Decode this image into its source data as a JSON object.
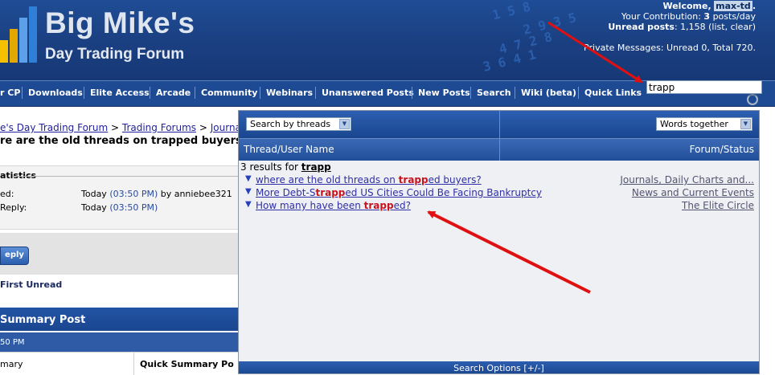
{
  "header": {
    "logo_title": "Big Mike's",
    "logo_subtitle": "Day Trading Forum",
    "welcome_prefix": "Welcome,",
    "username": "max-td",
    "welcome_suffix": ".",
    "contribution": "Your Contribution:",
    "contribution_count": "3",
    "contribution_suffix": "posts/day",
    "unread_label": "Unread posts",
    "unread_value": ": 1,158 (list, clear)",
    "private_messages": "Private Messages: Unread 0, Total 720."
  },
  "navbar": {
    "items": [
      "r CP",
      "Downloads",
      "Elite Access",
      "Arcade",
      "Community",
      "Webinars",
      "Unanswered Posts",
      "New Posts",
      "Search",
      "Wiki (beta)",
      "Quick Links"
    ],
    "search_value": "trapp"
  },
  "breadcrumb": {
    "items": [
      "e's Day Trading Forum",
      "Trading Forums",
      "Journals"
    ],
    "separator": ">"
  },
  "thread_title": "re are the old threads on trapped buyers",
  "stats": {
    "legend": "atistics",
    "rows": [
      {
        "label": "ed:",
        "date": "Today",
        "time": "(03:50 PM)",
        "by": "by anniebee321"
      },
      {
        "label": "Reply:",
        "date": "Today",
        "time": "(03:50 PM)",
        "by": ""
      }
    ]
  },
  "reply_button": "eply",
  "first_unread": "First Unread",
  "summary": {
    "title": "Summary Post",
    "date": "50 PM",
    "col1": "mary",
    "col2": "Quick Summary Po"
  },
  "popup": {
    "search_mode": "Search by threads",
    "match_mode": "Words together",
    "col_thread": "Thread/User Name",
    "col_forum": "Forum/Status",
    "results_prefix": "3 results for",
    "results_term": "trapp",
    "results": [
      {
        "before": "where are the old threads on ",
        "highlight": "trapp",
        "after": "ed buyers?",
        "forum": "Journals, Daily Charts and..."
      },
      {
        "before": "More Debt-S",
        "highlight": "trapp",
        "after": "ed US Cities Could Be Facing Bankruptcy",
        "forum": "News and Current Events"
      },
      {
        "before": "How many have been ",
        "highlight": "trapp",
        "after": "ed?",
        "forum": "The Elite Circle"
      }
    ],
    "footer": "Search Options [+/-]"
  },
  "colors": {
    "header_blue": "#1a3f80",
    "highlight_red": "#c8141e",
    "link_blue": "#2f2fa8",
    "arrow_red": "#e01010"
  }
}
